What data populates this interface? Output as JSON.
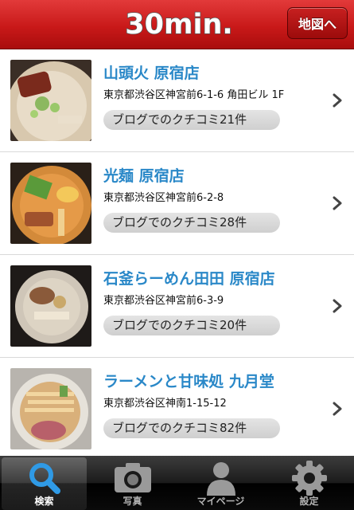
{
  "header": {
    "logo_text": "30min.",
    "map_button_label": "地図へ"
  },
  "list": [
    {
      "name": "山頭火 原宿店",
      "address": "東京都渋谷区神宮前6-1-6 角田ビル 1F",
      "badge": "ブログでのクチコミ21件"
    },
    {
      "name": "光麺 原宿店",
      "address": "東京都渋谷区神宮前6-2-8",
      "badge": "ブログでのクチコミ28件"
    },
    {
      "name": "石釜らーめん田田 原宿店",
      "address": "東京都渋谷区神宮前6-3-9",
      "badge": "ブログでのクチコミ20件"
    },
    {
      "name": "ラーメンと甘味処 九月堂",
      "address": "東京都渋谷区神南1-15-12",
      "badge": "ブログでのクチコミ82件"
    }
  ],
  "tabbar": {
    "tabs": [
      {
        "label": "検索",
        "icon": "search-icon",
        "active": true
      },
      {
        "label": "写真",
        "icon": "camera-icon",
        "active": false
      },
      {
        "label": "マイページ",
        "icon": "person-icon",
        "active": false
      },
      {
        "label": "設定",
        "icon": "gear-icon",
        "active": false
      }
    ]
  },
  "colors": {
    "header_red": "#c91919",
    "shop_name_blue": "#2a88c8",
    "tab_active_blue": "#2f9ae6"
  }
}
